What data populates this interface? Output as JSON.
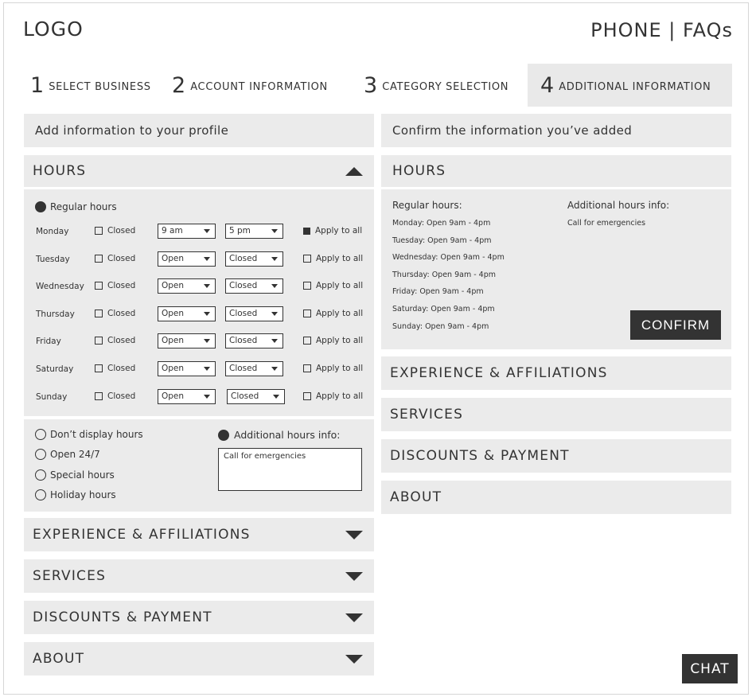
{
  "header": {
    "logo": "LOGO",
    "links": "PHONE | FAQs"
  },
  "steps": [
    {
      "number": "1",
      "label": "SELECT BUSINESS",
      "active": false
    },
    {
      "number": "2",
      "label": "ACCOUNT INFORMATION",
      "active": false
    },
    {
      "number": "3",
      "label": "CATEGORY SELECTION",
      "active": false
    },
    {
      "number": "4",
      "label": "ADDITIONAL INFORMATION",
      "active": true
    }
  ],
  "left": {
    "title": "Add information to your profile",
    "hours_section": {
      "title": "HOURS",
      "expanded": true,
      "regular_hours_label": "Regular hours",
      "closed_label": "Closed",
      "apply_label": "Apply to all",
      "days": [
        {
          "day": "Monday",
          "closed": false,
          "open": "9 am",
          "close": "5 pm",
          "apply_to_all": true
        },
        {
          "day": "Tuesday",
          "closed": false,
          "open": "Open",
          "close": "Closed",
          "apply_to_all": false
        },
        {
          "day": "Wednesday",
          "closed": false,
          "open": "Open",
          "close": "Closed",
          "apply_to_all": false
        },
        {
          "day": "Thursday",
          "closed": false,
          "open": "Open",
          "close": "Closed",
          "apply_to_all": false
        },
        {
          "day": "Friday",
          "closed": false,
          "open": "Open",
          "close": "Closed",
          "apply_to_all": false
        },
        {
          "day": "Saturday",
          "closed": false,
          "open": "Open",
          "close": "Closed",
          "apply_to_all": false
        },
        {
          "day": "Sunday",
          "closed": false,
          "open": "Open",
          "close": "Closed",
          "apply_to_all": false
        }
      ],
      "options": [
        {
          "label": "Don’t display hours",
          "selected": false
        },
        {
          "label": "Open 24/7",
          "selected": false
        },
        {
          "label": "Special hours",
          "selected": false
        },
        {
          "label": "Holiday hours",
          "selected": false
        }
      ],
      "additional_info_label": "Additional hours info:",
      "additional_info_value": "Call for emergencies"
    },
    "sections": [
      {
        "title": "EXPERIENCE & AFFILIATIONS"
      },
      {
        "title": "SERVICES"
      },
      {
        "title": "DISCOUNTS & PAYMENT"
      },
      {
        "title": "ABOUT"
      }
    ]
  },
  "right": {
    "title": "Confirm the information you’ve added",
    "hours_section": {
      "title": "HOURS",
      "regular_hours_label": "Regular hours:",
      "lines": [
        "Monday: Open 9am - 4pm",
        "Tuesday: Open 9am - 4pm",
        "Wednesday: Open 9am - 4pm",
        "Thursday: Open 9am - 4pm",
        "Friday: Open 9am - 4pm",
        "Saturday: Open 9am - 4pm",
        "Sunday: Open 9am - 4pm"
      ],
      "additional_label": "Additional hours info:",
      "additional_value": "Call for emergencies",
      "confirm_label": "CONFIRM"
    },
    "sections": [
      {
        "title": "EXPERIENCE & AFFILIATIONS"
      },
      {
        "title": "SERVICES"
      },
      {
        "title": "DISCOUNTS & PAYMENT"
      },
      {
        "title": "ABOUT"
      }
    ]
  },
  "chat_label": "CHAT"
}
